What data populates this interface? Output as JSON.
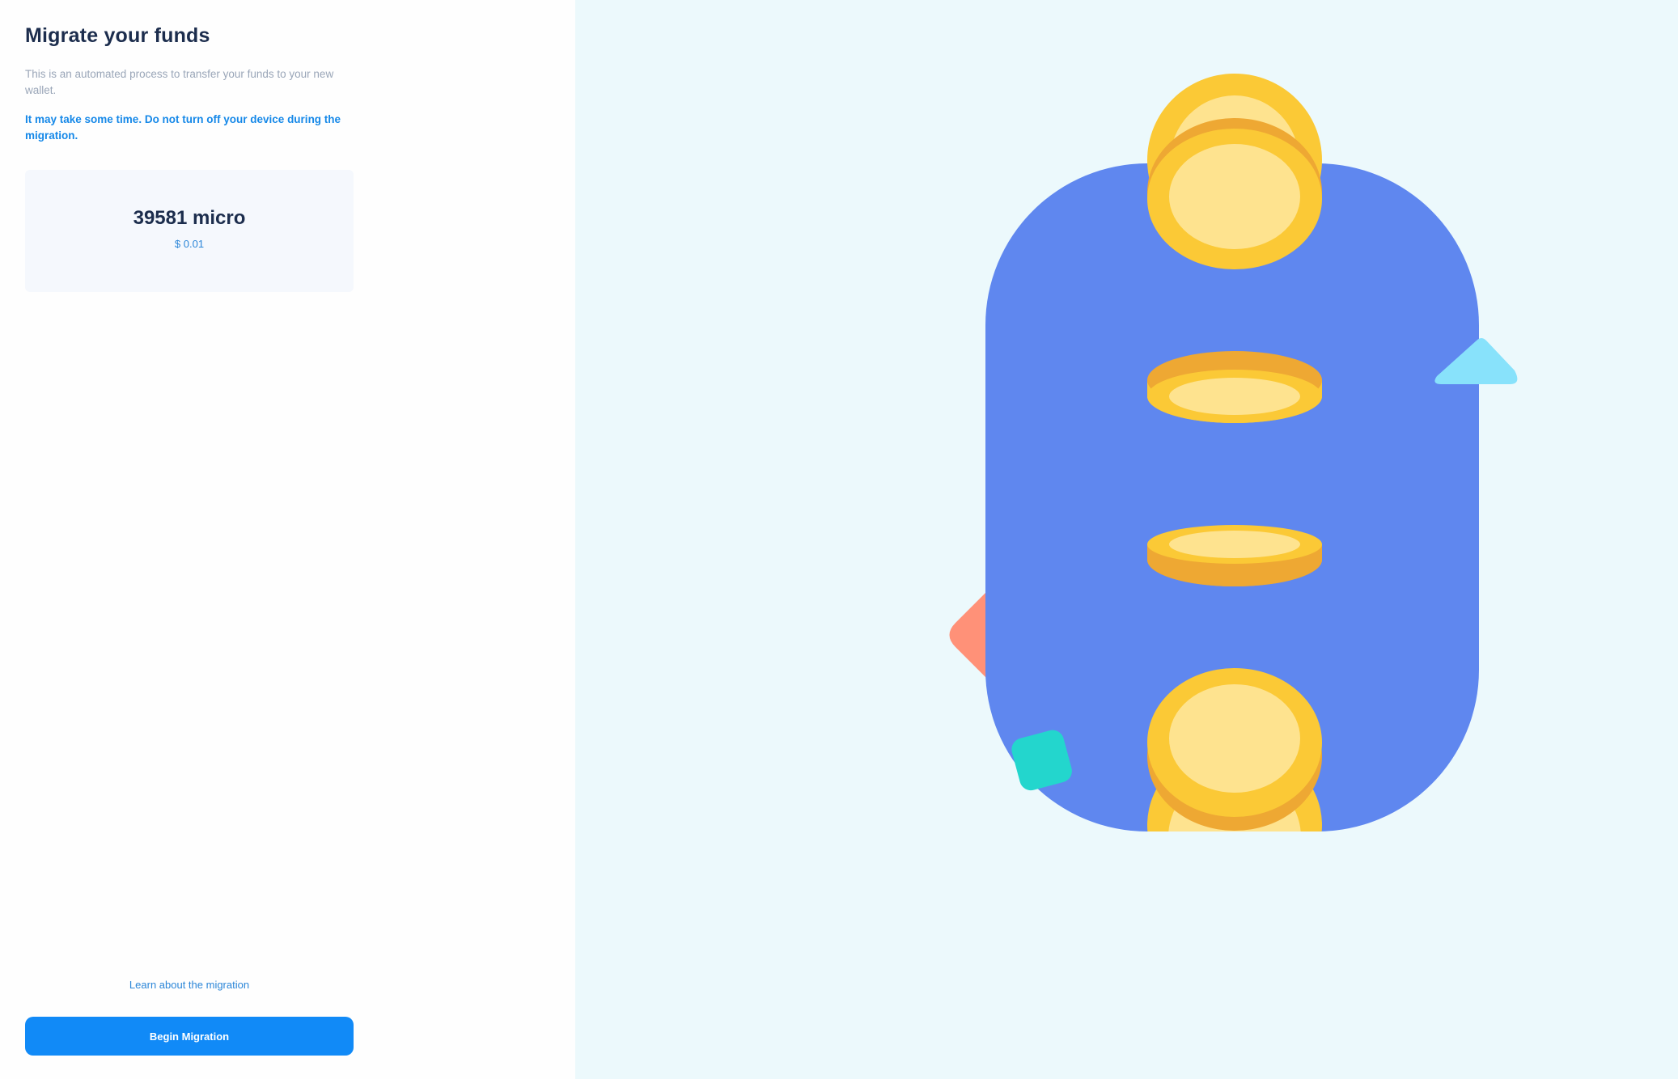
{
  "page": {
    "title": "Migrate your funds",
    "description": "This is an automated process to transfer your funds to your new wallet.",
    "warning": "It may take some time. Do not turn off your device during the migration."
  },
  "balance": {
    "amount": "39581 micro",
    "fiat": "$ 0.01"
  },
  "actions": {
    "learn_link": "Learn about the migration",
    "begin_button": "Begin Migration"
  },
  "colors": {
    "primary": "#118af7",
    "heading": "#1c2d4d",
    "muted": "#9aa6b8",
    "illustration_background": "#ecf9fc",
    "wallet_blue": "#5f87ef",
    "coin_gold": "#fbc936",
    "coin_light": "#fee38f",
    "coin_shadow": "#eea833"
  },
  "illustration": {
    "icons": [
      "wallet-icon",
      "coin-icon",
      "diamond-shape-icon",
      "triangle-shape-icon",
      "square-shape-icon"
    ]
  }
}
